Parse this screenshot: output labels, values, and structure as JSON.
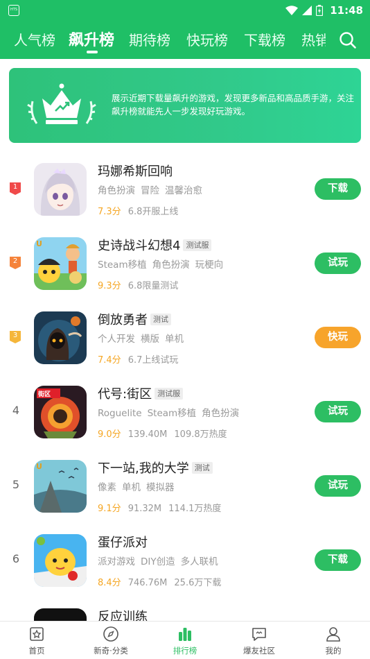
{
  "status_bar": {
    "time": "11:48",
    "app_icon_label": "HTS"
  },
  "tabs": [
    {
      "label": "人气榜",
      "active": false
    },
    {
      "label": "飙升榜",
      "active": true
    },
    {
      "label": "期待榜",
      "active": false
    },
    {
      "label": "快玩榜",
      "active": false
    },
    {
      "label": "下载榜",
      "active": false
    },
    {
      "label": "热销",
      "active": false
    }
  ],
  "banner": {
    "text": "展示近期下载量飙升的游戏，发现更多新品和高品质手游，关注飙升榜就能先人一步发现好玩游戏。"
  },
  "games": [
    {
      "rank": "1",
      "name": "玛娜希斯回响",
      "tag": "",
      "tags": [
        "角色扮演",
        "冒险",
        "温馨治愈"
      ],
      "score": "7.3分",
      "meta": [
        "6.8开服上线"
      ],
      "action": "下载",
      "action_color": "#2dbe63"
    },
    {
      "rank": "2",
      "name": "史诗战斗幻想4",
      "tag": "测试服",
      "tags": [
        "Steam移植",
        "角色扮演",
        "玩梗向"
      ],
      "score": "9.3分",
      "meta": [
        "6.8限量测试"
      ],
      "action": "试玩",
      "action_color": "#2dbe63"
    },
    {
      "rank": "3",
      "name": "倒放勇者",
      "tag": "测试",
      "tags": [
        "个人开发",
        "横版",
        "单机"
      ],
      "score": "7.4分",
      "meta": [
        "6.7上线试玩"
      ],
      "action": "快玩",
      "action_color": "#f7a42b"
    },
    {
      "rank": "4",
      "name": "代号:街区",
      "tag": "测试服",
      "tags": [
        "Roguelite",
        "Steam移植",
        "角色扮演"
      ],
      "score": "9.0分",
      "meta": [
        "139.40M",
        "109.8万热度"
      ],
      "action": "试玩",
      "action_color": "#2dbe63"
    },
    {
      "rank": "5",
      "name": "下一站,我的大学",
      "tag": "测试",
      "tags": [
        "像素",
        "单机",
        "模拟器"
      ],
      "score": "9.1分",
      "meta": [
        "91.32M",
        "114.1万热度"
      ],
      "action": "试玩",
      "action_color": "#2dbe63"
    },
    {
      "rank": "6",
      "name": "蛋仔派对",
      "tag": "",
      "tags": [
        "派对游戏",
        "DIY创造",
        "多人联机"
      ],
      "score": "8.4分",
      "meta": [
        "746.76M",
        "25.6万下载"
      ],
      "action": "下载",
      "action_color": "#2dbe63"
    },
    {
      "rank": "",
      "name": "反应训练",
      "tag": "",
      "tags": [],
      "score": "",
      "meta": [],
      "action": "",
      "action_color": "#2dbe63"
    }
  ],
  "bottom_nav": [
    {
      "label": "首页",
      "icon": "home-star-icon",
      "active": false
    },
    {
      "label": "新奇·分类",
      "icon": "compass-icon",
      "active": false
    },
    {
      "label": "排行榜",
      "icon": "bar-chart-icon",
      "active": true
    },
    {
      "label": "爆友社区",
      "icon": "chat-bubble-icon",
      "active": false
    },
    {
      "label": "我的",
      "icon": "person-icon",
      "active": false
    }
  ],
  "colors": {
    "brand_green": "#1fbf66",
    "button_green": "#2dbe63",
    "button_orange": "#f7a42b",
    "score_orange": "#f5a623",
    "rank1": "#f04a4a",
    "rank2": "#f5833a",
    "rank3": "#f5b63a"
  }
}
